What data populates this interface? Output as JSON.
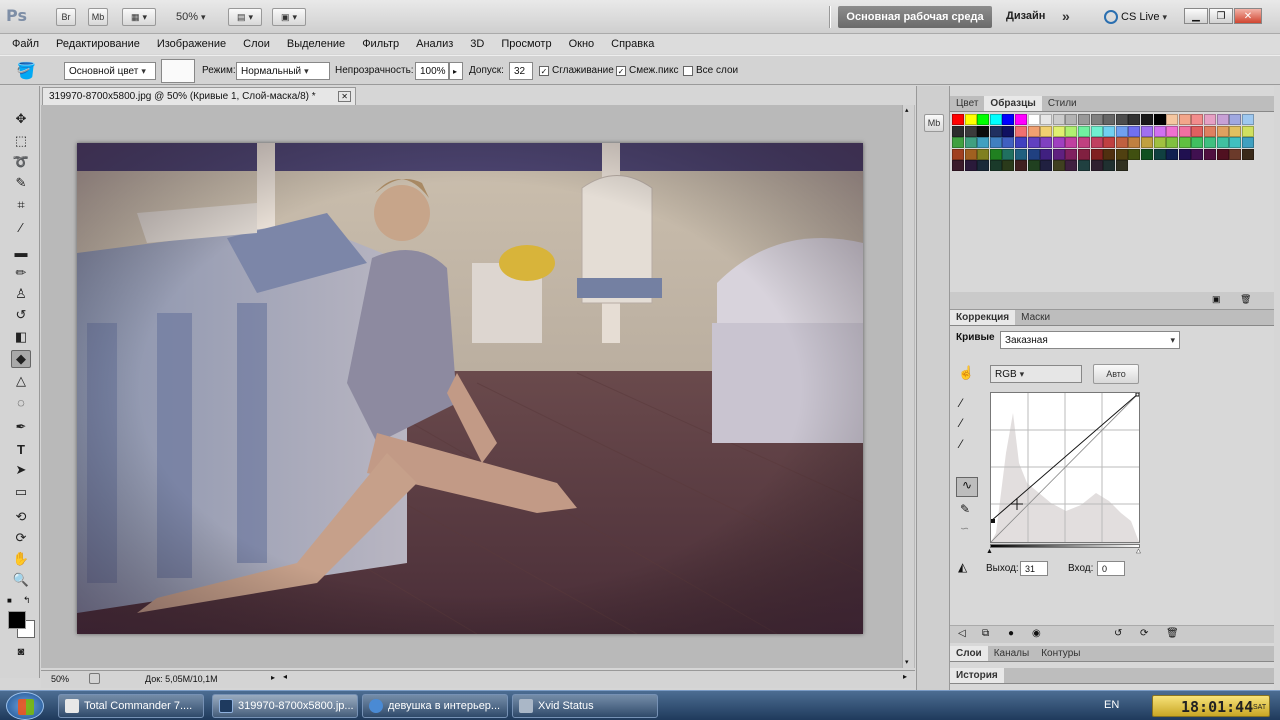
{
  "app": {
    "logo": "Ps",
    "bridge": "Br",
    "mini_bridge": "Mb",
    "zoom": "50%",
    "workspace": "Основная рабочая среда",
    "design": "Дизайн",
    "cs_live": "CS Live"
  },
  "menu": [
    "Файл",
    "Редактирование",
    "Изображение",
    "Слои",
    "Выделение",
    "Фильтр",
    "Анализ",
    "3D",
    "Просмотр",
    "Окно",
    "Справка"
  ],
  "options": {
    "fill_source": "Основной цвет",
    "mode_label": "Режим:",
    "mode_value": "Нормальный",
    "opacity_label": "Непрозрачность:",
    "opacity_value": "100%",
    "tolerance_label": "Допуск:",
    "tolerance_value": "32",
    "antialias_label": "Сглаживание",
    "contiguous_label": "Смеж.пикс",
    "all_layers_label": "Все слои"
  },
  "document": {
    "tab_title": "319970-8700x5800.jpg @ 50% (Кривые 1, Слой-маска/8) *",
    "status_zoom": "50%",
    "status_doc": "Док: 5,05M/10,1M"
  },
  "panels": {
    "top_tabs": [
      "Цвет",
      "Образцы",
      "Стили"
    ],
    "correction_tabs": [
      "Коррекция",
      "Маски"
    ],
    "curves_label": "Кривые",
    "preset": "Заказная",
    "channel": "RGB",
    "auto_button": "Авто",
    "output_label": "Выход:",
    "output_value": "31",
    "input_label": "Вход:",
    "input_value": "0",
    "layer_tabs": [
      "Слои",
      "Каналы",
      "Контуры"
    ],
    "history_tab": "История"
  },
  "taskbar": {
    "items": [
      "Total Commander 7....",
      "319970-8700x5800.jp...",
      "девушка в интерьер...",
      "Xvid Status"
    ],
    "lang": "EN",
    "time": "18:01:44",
    "day": "SAT"
  },
  "colors": {
    "workspace_bg": "#7a7a7a",
    "taskbar": "#2a4a70",
    "photo_shadow": "#5a4150"
  }
}
